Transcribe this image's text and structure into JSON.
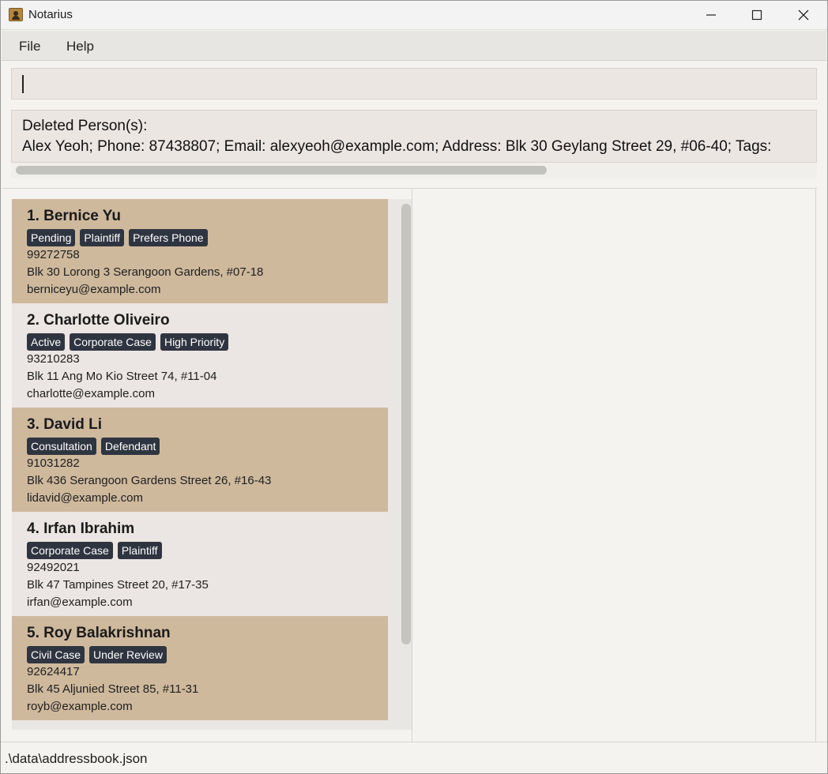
{
  "window": {
    "title": "Notarius",
    "app_icon": "address-book-icon",
    "controls": [
      "minimize-icon",
      "maximize-icon",
      "close-icon"
    ]
  },
  "menu": {
    "file": "File",
    "help": "Help"
  },
  "command_box": {
    "value": ""
  },
  "result": {
    "line1": "Deleted Person(s):",
    "line2": "Alex Yeoh; Phone: 87438807; Email: alexyeoh@example.com; Address: Blk 30 Geylang Street 29, #06-40; Tags: "
  },
  "persons": [
    {
      "name": "1. Bernice Yu",
      "tags": [
        "Pending",
        "Plaintiff",
        "Prefers Phone"
      ],
      "phone": "99272758",
      "address": "Blk 30 Lorong 3 Serangoon Gardens, #07-18",
      "email": "berniceyu@example.com"
    },
    {
      "name": "2. Charlotte Oliveiro",
      "tags": [
        "Active",
        "Corporate Case",
        "High Priority"
      ],
      "phone": "93210283",
      "address": "Blk 11 Ang Mo Kio Street 74, #11-04",
      "email": "charlotte@example.com"
    },
    {
      "name": "3. David Li",
      "tags": [
        "Consultation",
        "Defendant"
      ],
      "phone": "91031282",
      "address": "Blk 436 Serangoon Gardens Street 26, #16-43",
      "email": "lidavid@example.com"
    },
    {
      "name": "4. Irfan Ibrahim",
      "tags": [
        "Corporate Case",
        "Plaintiff"
      ],
      "phone": "92492021",
      "address": "Blk 47 Tampines Street 20, #17-35",
      "email": "irfan@example.com"
    },
    {
      "name": "5. Roy Balakrishnan",
      "tags": [
        "Civil Case",
        "Under Review"
      ],
      "phone": "92624417",
      "address": "Blk 45 Aljunied Street 85, #11-31",
      "email": "royb@example.com"
    }
  ],
  "status": {
    "path": ".\\data\\addressbook.json"
  },
  "colors": {
    "card_odd": "#cfb99d",
    "card_even": "#ebe5e3",
    "tag_bg": "#2f3540",
    "tag_text": "#ffffff"
  }
}
